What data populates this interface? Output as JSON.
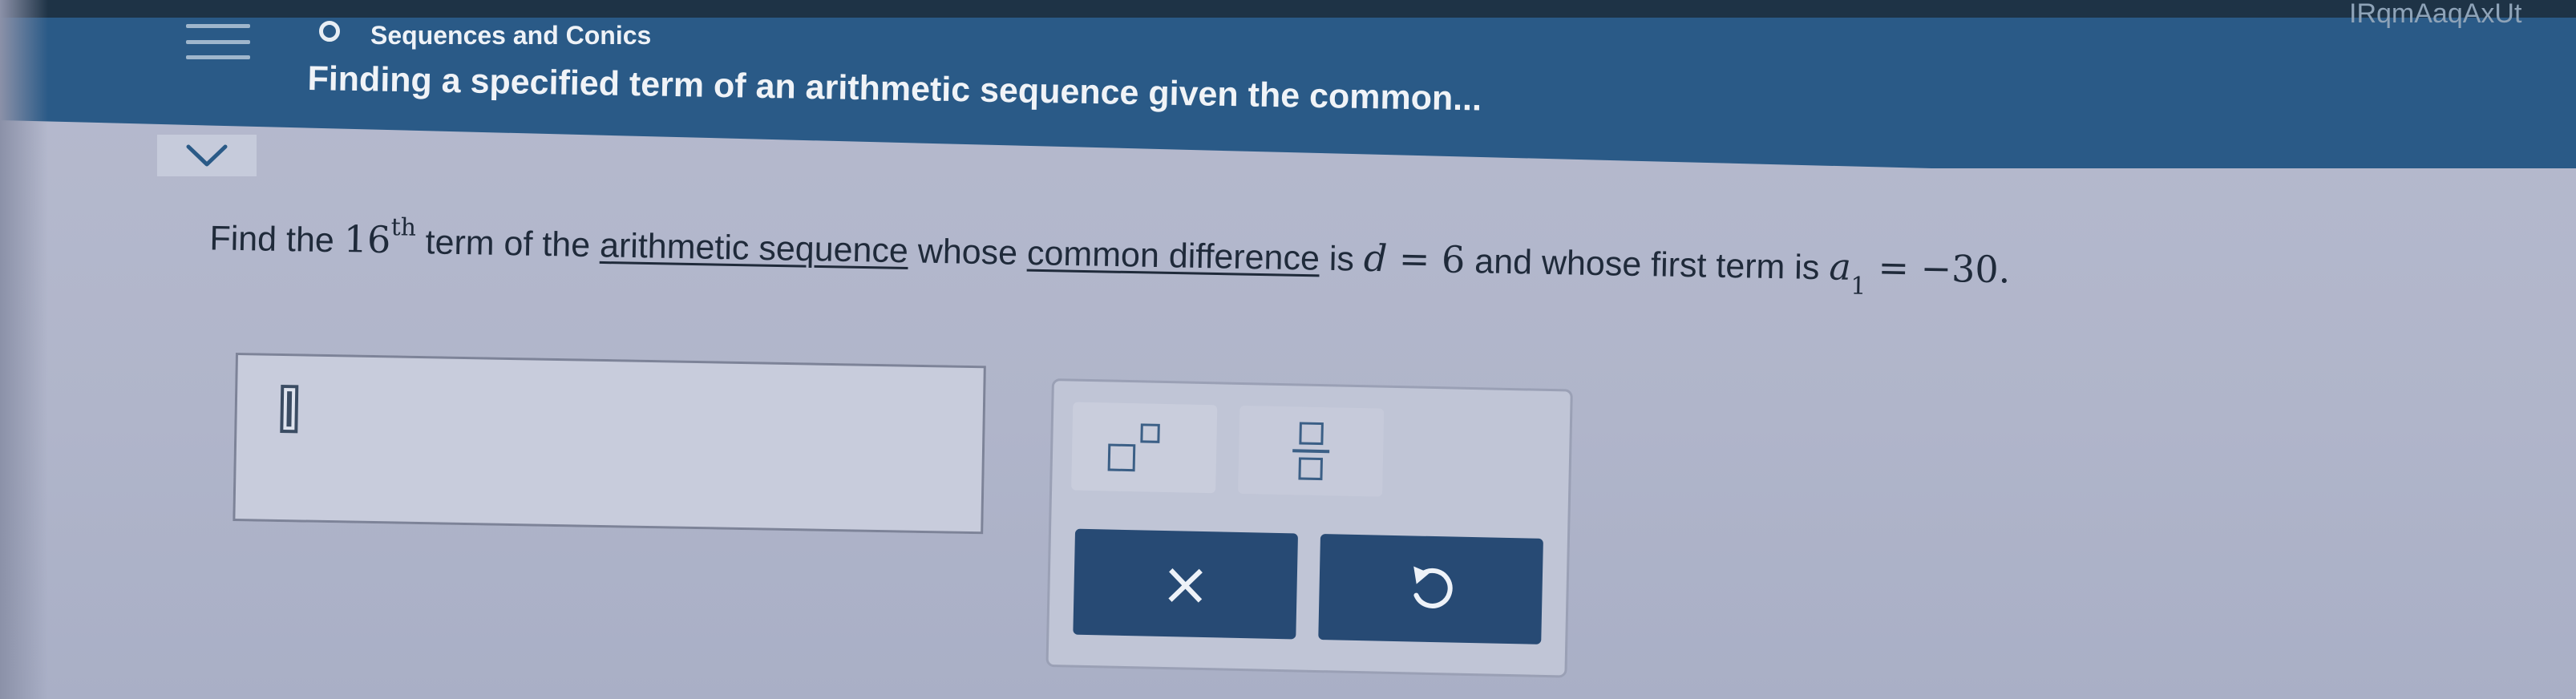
{
  "header": {
    "topic": "Sequences and Conics",
    "lesson_title": "Finding a specified term of an arithmetic sequence given the common...",
    "top_right_fragment": "IRqmAaqAxUt"
  },
  "question": {
    "prefix": "Find the",
    "term_number": "16",
    "term_suffix": "th",
    "text_before_link1": "term of the",
    "link1": "arithmetic sequence",
    "text_between_links": "whose",
    "link2": "common difference",
    "text_is": "is",
    "d_var": "d",
    "d_eq": " = ",
    "d_value": "6",
    "text_and_first": "and whose first term is",
    "a_var": "a",
    "a_sub": "1",
    "a_eq": " = ",
    "a_value": "−30."
  },
  "keypad": {
    "exponent_key": "superscript-template",
    "fraction_key": "fraction-template",
    "clear_key": "×",
    "undo_key": "undo"
  },
  "colors": {
    "header_bg": "#2a5a87",
    "button_bg": "#274a74",
    "page_bg": "#b3b8cc"
  }
}
